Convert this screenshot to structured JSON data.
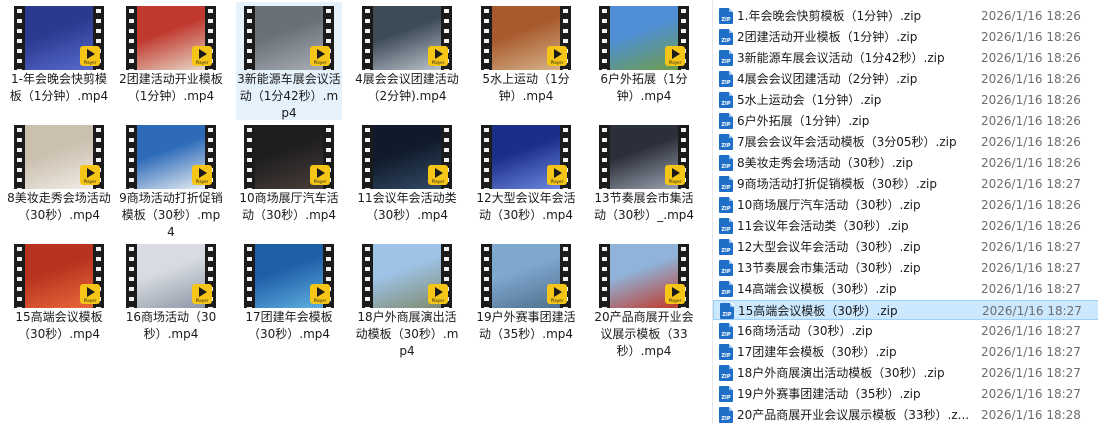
{
  "thumbnails": [
    {
      "name": "1-年会晚会快剪模板（1分钟）.mp4",
      "colors": [
        "#2a3a8f",
        "#5a6ad0"
      ]
    },
    {
      "name": "2团建活动开业模板（1分钟）.mp4",
      "colors": [
        "#c0382e",
        "#e8d9c7"
      ]
    },
    {
      "name": "3新能源车展会议活动（1分42秒）.mp4",
      "colors": [
        "#6a7078",
        "#a9aeb5"
      ]
    },
    {
      "name": "4展会会议团建活动（2分钟).mp4",
      "colors": [
        "#3d4b57",
        "#b9c3cc"
      ]
    },
    {
      "name": "5水上运动（1分钟）.mp4",
      "colors": [
        "#a85a2d",
        "#d6b38b"
      ]
    },
    {
      "name": "6户外拓展（1分钟）.mp4",
      "colors": [
        "#4f8fd6",
        "#6d9c4a"
      ]
    },
    {
      "name": "8美妆走秀会场活动（30秒）.mp4",
      "colors": [
        "#cbbfae",
        "#f0ece6"
      ]
    },
    {
      "name": "9商场活动打折促销模板（30秒）.mp4",
      "colors": [
        "#2d6bb8",
        "#e7edf3"
      ]
    },
    {
      "name": "10商场展厅汽车活动（30秒）.mp4",
      "colors": [
        "#1e1d20",
        "#4a3f3a"
      ]
    },
    {
      "name": "11会议年会活动类（30秒）.mp4",
      "colors": [
        "#0f1a2a",
        "#334a66"
      ]
    },
    {
      "name": "12大型会议年会活动（30秒）.mp4",
      "colors": [
        "#1a2f88",
        "#6f87e0"
      ]
    },
    {
      "name": "13节奏展会市集活动（30秒）_.mp4",
      "colors": [
        "#2b2f3a",
        "#9aa2b0"
      ]
    },
    {
      "name": "15高端会议模板（30秒）.mp4",
      "colors": [
        "#b8321f",
        "#e86a3a"
      ]
    },
    {
      "name": "16商场活动（30秒）.mp4",
      "colors": [
        "#d8dce2",
        "#8d97a6"
      ]
    },
    {
      "name": "17团建年会模板（30秒）.mp4",
      "colors": [
        "#1f5fa8",
        "#5fb0e0"
      ]
    },
    {
      "name": "18户外商展演出活动模板（30秒）.mp4",
      "colors": [
        "#9ec3e6",
        "#7f8a70"
      ]
    },
    {
      "name": "19户外赛事团建活动（35秒）.mp4",
      "colors": [
        "#7fa8cf",
        "#4d6f8c"
      ]
    },
    {
      "name": "20产品商展开业会议展示模板（33秒）.mp4",
      "colors": [
        "#8fb3d9",
        "#c0392b"
      ]
    }
  ],
  "selected_thumbnail_index": 2,
  "badge_text": "Player",
  "zip_icon_text": "ZIP",
  "files": [
    {
      "name": "1.年会晚会快剪模板（1分钟）.zip",
      "date": "2026/1/16 18:26"
    },
    {
      "name": "2团建活动开业模板（1分钟）.zip",
      "date": "2026/1/16 18:26"
    },
    {
      "name": "3新能源车展会议活动（1分42秒）.zip",
      "date": "2026/1/16 18:26"
    },
    {
      "name": "4展会会议团建活动（2分钟）.zip",
      "date": "2026/1/16 18:26"
    },
    {
      "name": "5水上运动会（1分钟）.zip",
      "date": "2026/1/16 18:26"
    },
    {
      "name": "6户外拓展（1分钟）.zip",
      "date": "2026/1/16 18:26"
    },
    {
      "name": "7展会会议年会活动模板（3分05秒）.zip",
      "date": "2026/1/16 18:26"
    },
    {
      "name": "8美妆走秀会场活动（30秒）.zip",
      "date": "2026/1/16 18:26"
    },
    {
      "name": "9商场活动打折促销模板（30秒）.zip",
      "date": "2026/1/16 18:27"
    },
    {
      "name": "10商场展厅汽车活动（30秒）.zip",
      "date": "2026/1/16 18:26"
    },
    {
      "name": "11会议年会活动类（30秒）.zip",
      "date": "2026/1/16 18:26"
    },
    {
      "name": "12大型会议年会活动（30秒）.zip",
      "date": "2026/1/16 18:27"
    },
    {
      "name": "13节奏展会市集活动（30秒）.zip",
      "date": "2026/1/16 18:27"
    },
    {
      "name": "14高端会议模板（30秒）.zip",
      "date": "2026/1/16 18:27"
    },
    {
      "name": "15高端会议模板（30秒）.zip",
      "date": "2026/1/16 18:27"
    },
    {
      "name": "16商场活动（30秒）.zip",
      "date": "2026/1/16 18:27"
    },
    {
      "name": "17团建年会模板（30秒）.zip",
      "date": "2026/1/16 18:27"
    },
    {
      "name": "18户外商展演出活动模板（30秒）.zip",
      "date": "2026/1/16 18:27"
    },
    {
      "name": "19户外赛事团建活动（35秒）.zip",
      "date": "2026/1/16 18:27"
    },
    {
      "name": "20产品商展开业会议展示模板（33秒）.z...",
      "date": "2026/1/16 18:28"
    }
  ],
  "selected_file_index": 14
}
